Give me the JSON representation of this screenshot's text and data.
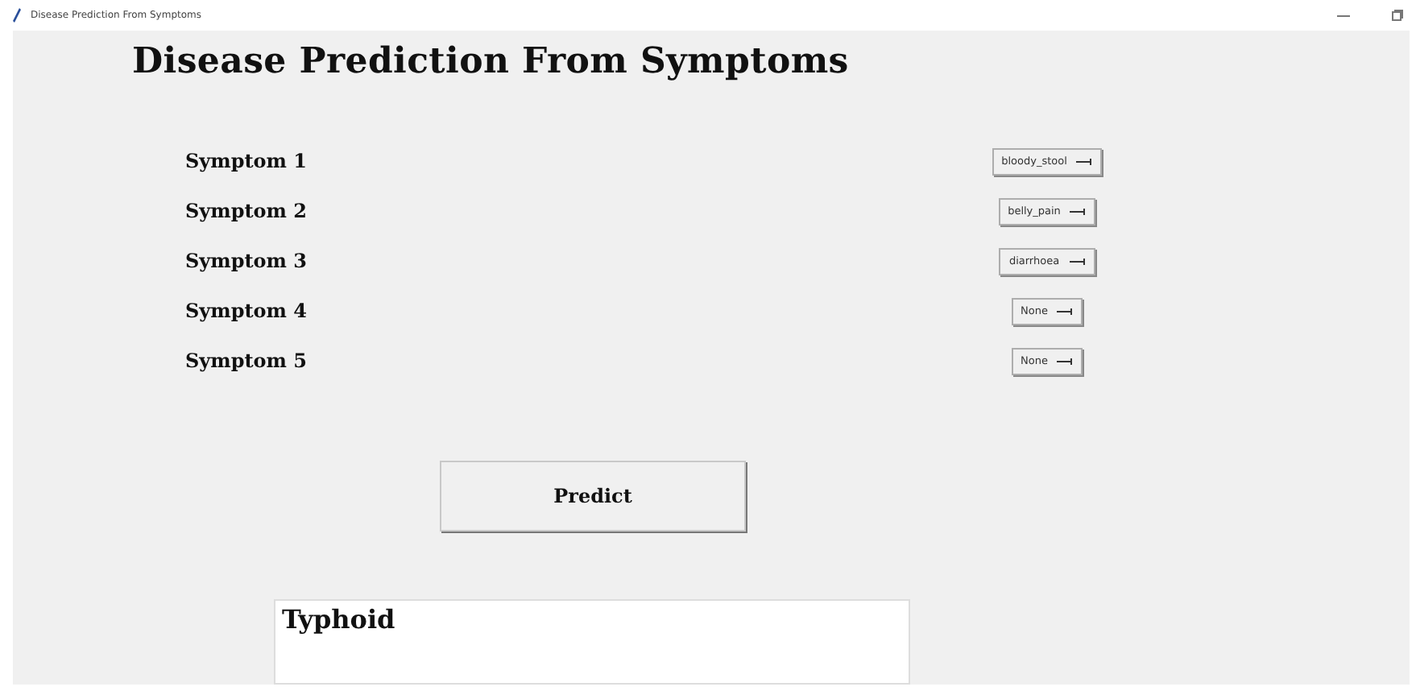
{
  "window": {
    "title": "Disease Prediction From Symptoms"
  },
  "heading": "Disease Prediction From Symptoms",
  "symptoms": [
    {
      "label": "Symptom 1",
      "value": "bloody_stool"
    },
    {
      "label": "Symptom 2",
      "value": "belly_pain"
    },
    {
      "label": "Symptom 3",
      "value": "diarrhoea"
    },
    {
      "label": "Symptom 4",
      "value": "None"
    },
    {
      "label": "Symptom 5",
      "value": "None"
    }
  ],
  "predict_button": "Predict",
  "result": "Typhoid"
}
